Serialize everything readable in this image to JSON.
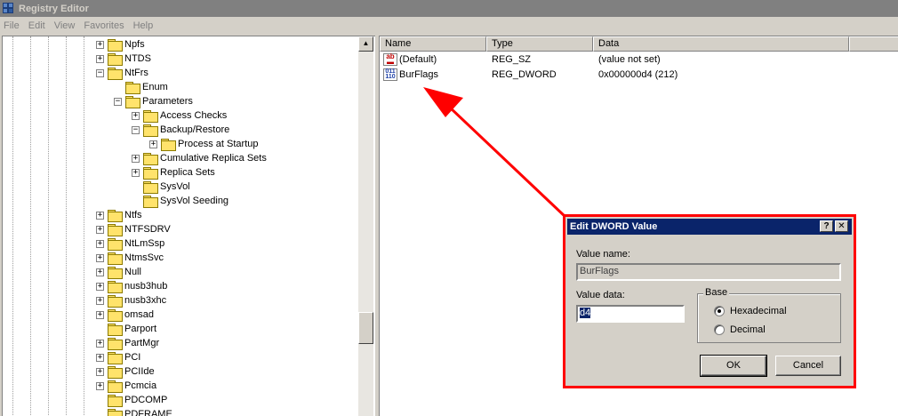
{
  "window": {
    "title": "Registry Editor"
  },
  "menu": [
    "File",
    "Edit",
    "View",
    "Favorites",
    "Help"
  ],
  "tree": [
    {
      "label": "Npfs",
      "level": 0,
      "expander": "+"
    },
    {
      "label": "NTDS",
      "level": 0,
      "expander": "+"
    },
    {
      "label": "NtFrs",
      "level": 0,
      "expander": "-"
    },
    {
      "label": "Enum",
      "level": 1,
      "expander": ""
    },
    {
      "label": "Parameters",
      "level": 1,
      "expander": "-"
    },
    {
      "label": "Access Checks",
      "level": 2,
      "expander": "+"
    },
    {
      "label": "Backup/Restore",
      "level": 2,
      "expander": "-"
    },
    {
      "label": "Process at Startup",
      "level": 3,
      "expander": "+"
    },
    {
      "label": "Cumulative Replica Sets",
      "level": 2,
      "expander": "+"
    },
    {
      "label": "Replica Sets",
      "level": 2,
      "expander": "+"
    },
    {
      "label": "SysVol",
      "level": 2,
      "expander": ""
    },
    {
      "label": "SysVol Seeding",
      "level": 2,
      "expander": ""
    },
    {
      "label": "Ntfs",
      "level": 0,
      "expander": "+"
    },
    {
      "label": "NTFSDRV",
      "level": 0,
      "expander": "+"
    },
    {
      "label": "NtLmSsp",
      "level": 0,
      "expander": "+"
    },
    {
      "label": "NtmsSvc",
      "level": 0,
      "expander": "+"
    },
    {
      "label": "Null",
      "level": 0,
      "expander": "+"
    },
    {
      "label": "nusb3hub",
      "level": 0,
      "expander": "+"
    },
    {
      "label": "nusb3xhc",
      "level": 0,
      "expander": "+"
    },
    {
      "label": "omsad",
      "level": 0,
      "expander": "+"
    },
    {
      "label": "Parport",
      "level": 0,
      "expander": ""
    },
    {
      "label": "PartMgr",
      "level": 0,
      "expander": "+"
    },
    {
      "label": "PCI",
      "level": 0,
      "expander": "+"
    },
    {
      "label": "PCIIde",
      "level": 0,
      "expander": "+"
    },
    {
      "label": "Pcmcia",
      "level": 0,
      "expander": "+"
    },
    {
      "label": "PDCOMP",
      "level": 0,
      "expander": ""
    },
    {
      "label": "PDFRAME",
      "level": 0,
      "expander": ""
    }
  ],
  "list": {
    "columns": [
      "Name",
      "Type",
      "Data"
    ],
    "rows": [
      {
        "name": "(Default)",
        "type": "REG_SZ",
        "data": "(value not set)",
        "icon": "string-value-icon"
      },
      {
        "name": "BurFlags",
        "type": "REG_DWORD",
        "data": "0x000000d4 (212)",
        "icon": "binary-value-icon"
      }
    ]
  },
  "dialog": {
    "title": "Edit DWORD Value",
    "help_btn": "?",
    "close_btn": "✕",
    "value_name_label": "Value name:",
    "value_name": "BurFlags",
    "value_data_label": "Value data:",
    "value_data": "d4",
    "base_label": "Base",
    "hex_label": "Hexadecimal",
    "dec_label": "Decimal",
    "base_selected": "Hexadecimal",
    "ok_label": "OK",
    "cancel_label": "Cancel"
  },
  "colors": {
    "highlight": "#ff0000",
    "title_active": "#0a246a"
  }
}
